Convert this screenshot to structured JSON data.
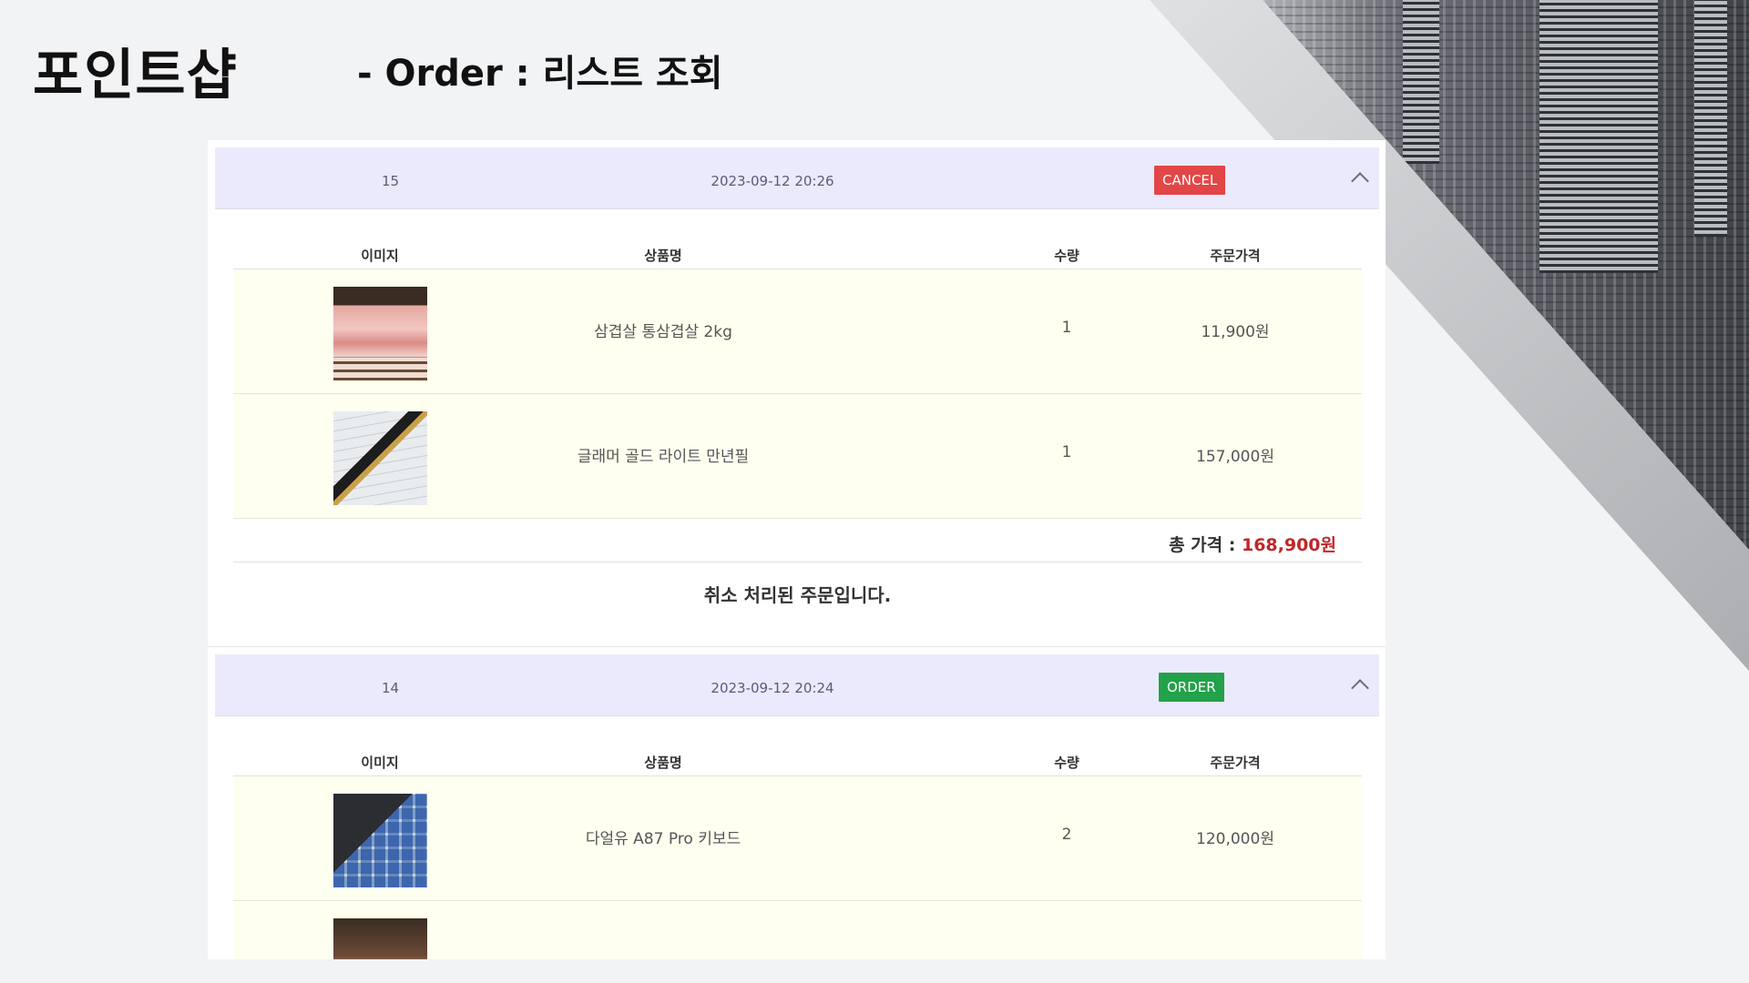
{
  "slide": {
    "brand": "포인트샵",
    "subtitle": "- Order : 리스트 조회"
  },
  "colors": {
    "header_bg": "#ebeafc",
    "cancel_badge": "#e24646",
    "order_badge": "#22a24a",
    "item_row_bg": "#fffff0",
    "total_amount": "#c0262b"
  },
  "table_headers": {
    "image": "이미지",
    "name": "상품명",
    "qty": "수량",
    "price": "주문가격"
  },
  "orders": [
    {
      "id": "15",
      "date": "2023-09-12 20:26",
      "status": "CANCEL",
      "items": [
        {
          "image": "pork-belly-photo",
          "name": "삼겹살 통삼겹살 2kg",
          "qty": "1",
          "price": "11,900원"
        },
        {
          "image": "fountain-pen-photo",
          "name": "글래머 골드 라이트 만년필",
          "qty": "1",
          "price": "157,000원"
        }
      ],
      "total_label": "총 가격 : ",
      "total_amount": "168,900원",
      "note": "취소 처리된 주문입니다."
    },
    {
      "id": "14",
      "date": "2023-09-12 20:24",
      "status": "ORDER",
      "items": [
        {
          "image": "keyboard-photo",
          "name": "다얼유 A87 Pro 키보드",
          "qty": "2",
          "price": "120,000원"
        },
        {
          "image": "pork-belly-photo",
          "name": "",
          "qty": "",
          "price": ""
        }
      ]
    }
  ]
}
